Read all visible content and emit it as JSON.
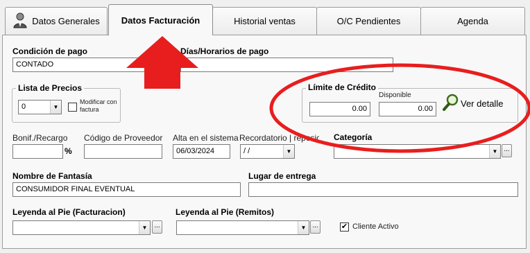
{
  "tabs": [
    {
      "label": "Datos Generales"
    },
    {
      "label": "Datos Facturación"
    },
    {
      "label": "Historial ventas"
    },
    {
      "label": "O/C Pendientes"
    },
    {
      "label": "Agenda"
    }
  ],
  "active_tab_index": 1,
  "form": {
    "condicion_pago": {
      "label": "Condición de pago",
      "value": "CONTADO"
    },
    "dias_horarios": {
      "label": "Días/Horarios de pago",
      "value": ""
    },
    "lista_precios": {
      "title": "Lista de Precios",
      "value": "0",
      "modificar_label_1": "Modificar con",
      "modificar_label_2": "factura",
      "modificar_checked": false
    },
    "limite_credito": {
      "title": "Límite de Crédito",
      "value": "0.00",
      "disponible_label": "Disponible",
      "disponible_value": "0.00",
      "ver_detalle": "Ver detalle"
    },
    "bonif": {
      "label": "Bonif./Recargo",
      "value": "",
      "unit": "%"
    },
    "codigo_proveedor": {
      "label": "Código de Proveedor",
      "value": ""
    },
    "alta_sistema": {
      "label": "Alta en el sistema",
      "value": "06/03/2024"
    },
    "recordatorio": {
      "label": "Recordatorio | reposición",
      "value": " /  /"
    },
    "categoria": {
      "label": "Categoría",
      "value": ""
    },
    "nombre_fantasia": {
      "label": "Nombre de Fantasía",
      "value": "CONSUMIDOR FINAL EVENTUAL"
    },
    "lugar_entrega": {
      "label": "Lugar de entrega",
      "value": ""
    },
    "leyenda_facturacion": {
      "label": "Leyenda al Pie (Facturacion)",
      "value": ""
    },
    "leyenda_remitos": {
      "label": "Leyenda al Pie (Remitos)",
      "value": ""
    },
    "cliente_activo": {
      "label": "Cliente Activo",
      "checked": true
    }
  },
  "annotations": {
    "arrow_color": "#e81e1e",
    "ellipse_color": "#e81e1e"
  },
  "icons": {
    "user": "user-icon",
    "search": "magnifier-icon",
    "dropdown": "chevron-down-icon"
  }
}
